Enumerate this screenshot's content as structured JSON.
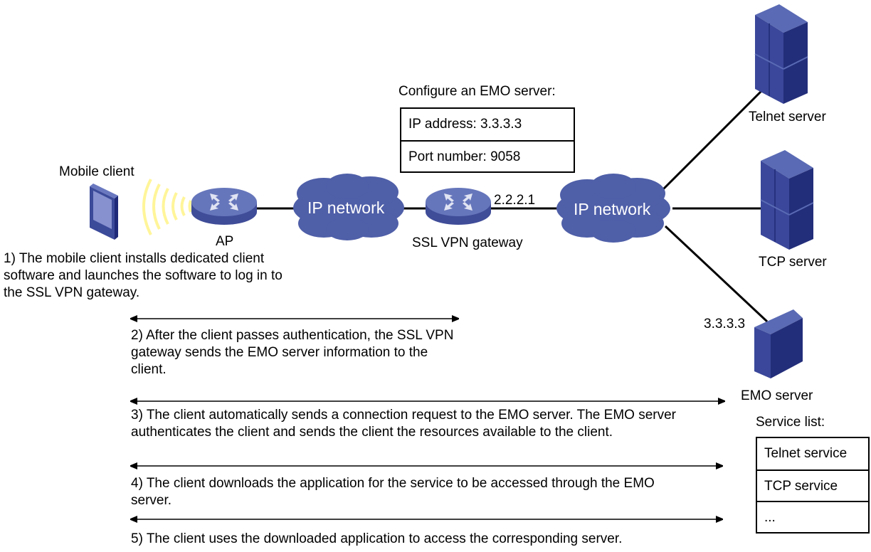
{
  "devices": {
    "mobile_client": "Mobile client",
    "ap": "AP",
    "ip_network_left": "IP network",
    "ssl_vpn_gateway": "SSL VPN gateway",
    "gateway_ip": "2.2.2.1",
    "ip_network_right": "IP network",
    "telnet_server": "Telnet server",
    "tcp_server": "TCP server",
    "emo_server": "EMO server",
    "emo_ip": "3.3.3.3"
  },
  "emo_config": {
    "title": "Configure an EMO server:",
    "rows": [
      "IP address: 3.3.3.3",
      "Port number: 9058"
    ]
  },
  "service_list": {
    "title": "Service list:",
    "rows": [
      "Telnet service",
      "TCP service",
      "..."
    ]
  },
  "steps": [
    "1) The mobile client installs dedicated client software and launches the software to log in to the SSL VPN gateway.",
    "2) After the client passes authentication, the SSL VPN gateway sends the EMO server information to the client.",
    "3) The client automatically sends a connection request to the EMO server. The EMO server authenticates the client and sends the client the resources available to the client.",
    "4) The client downloads the application for the service to be accessed through the EMO server.",
    "5) The client uses the downloaded application to access the corresponding server."
  ],
  "colors": {
    "device_blue": "#4f5fa8",
    "device_dark": "#2a3580",
    "wifi_yellow": "#fff59a",
    "line": "#000000"
  }
}
